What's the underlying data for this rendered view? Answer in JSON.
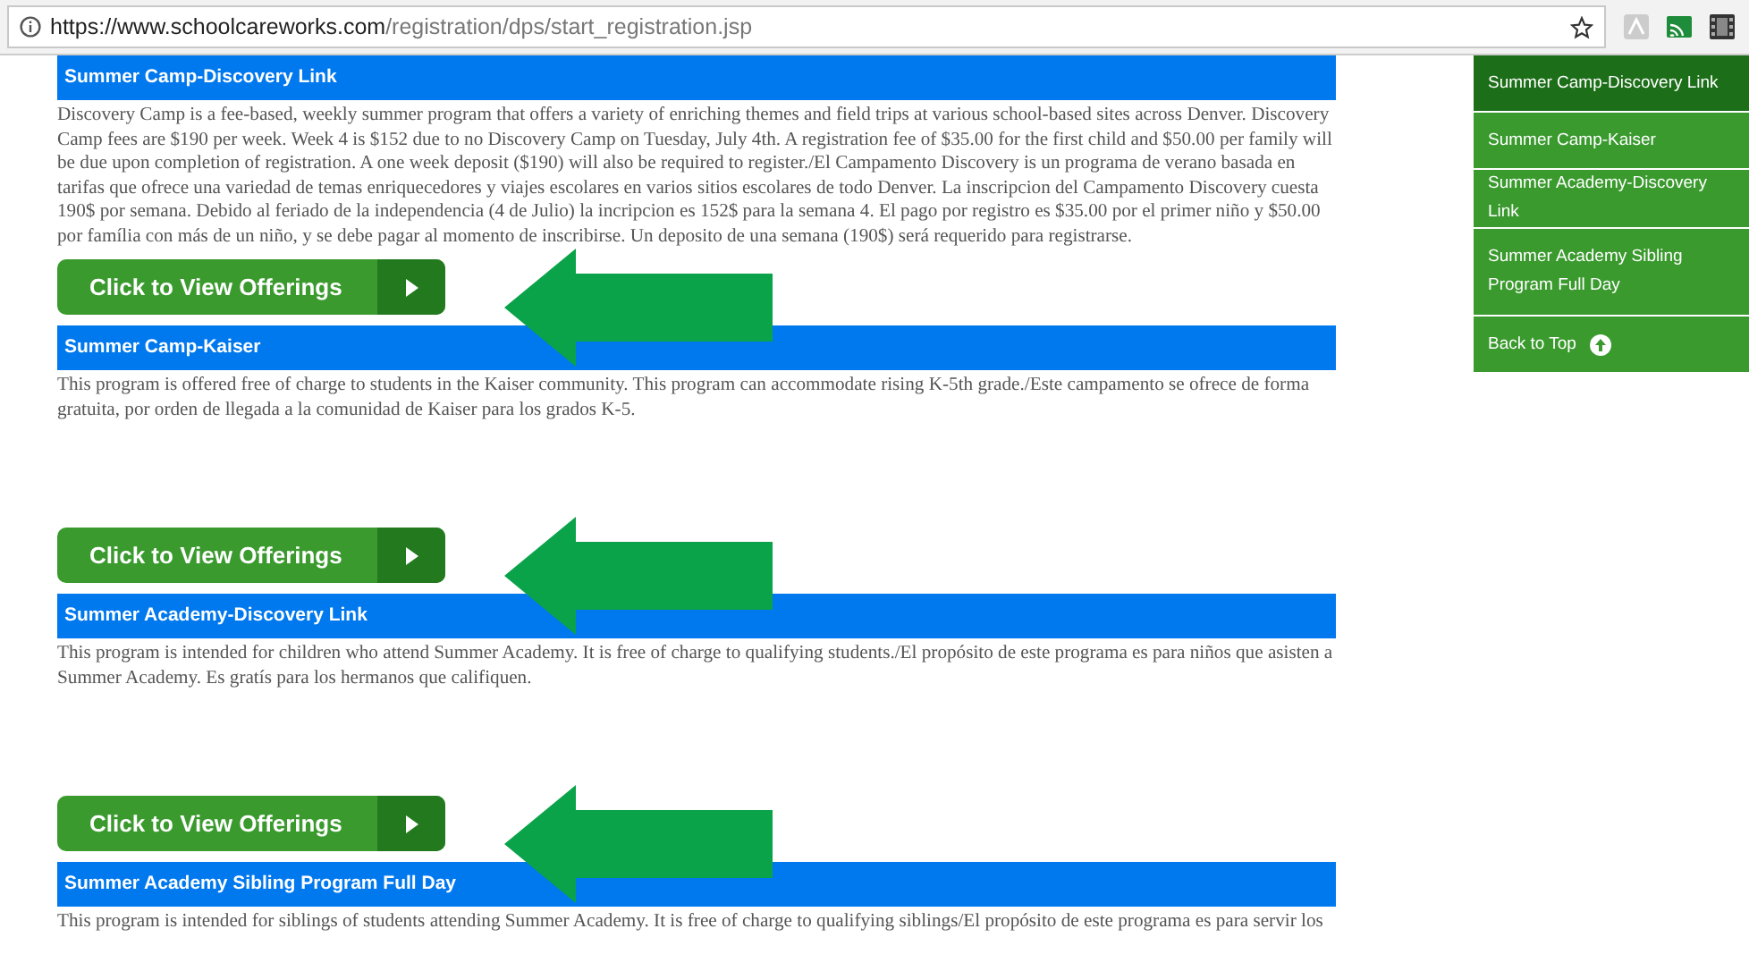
{
  "browser": {
    "url_host": "https://www.schoolcareworks.com",
    "url_path": "/registration/dps/start_registration.jsp"
  },
  "sections": [
    {
      "title": "Summer Camp-Discovery Link",
      "text": "Discovery Camp is a fee-based, weekly summer program that offers a variety of enriching themes and field trips at various school-based sites across Denver. Discovery Camp fees are $190 per week. Week 4 is $152 due to no Discovery Camp on Tuesday, July 4th. A registration fee of $35.00 for the first child and $50.00 per family will be due upon completion of registration.  A one week deposit ($190) will also be required to register./El Campamento Discovery is un programa de verano basada en tarifas que ofrece una variedad de temas enriquecedores y viajes escolares en varios sitios escolares de todo Denver. La inscripcion del Campamento Discovery cuesta 190$ por semana. Debido al feriado de la independencia (4 de Julio) la incripcion es 152$ para la semana 4. El pago por registro es $35.00 por el primer niño y $50.00 por família con más de un niño, y se debe pagar al momento de inscribirse. Un deposito de una semana (190$) será requerido para registrarse.",
      "button": "Click to View Offerings"
    },
    {
      "title": "Summer Camp-Kaiser",
      "text": "This program is offered free of charge to students in the Kaiser community. This program can accommodate rising K-5th grade./Este campamento se ofrece de forma gratuita, por orden de llegada a la comunidad de Kaiser para los grados K-5.",
      "button": "Click to View Offerings"
    },
    {
      "title": "Summer Academy-Discovery Link",
      "text": "This program is intended for children who attend Summer Academy. It is free of charge to qualifying students./El propósito de este programa es para niños que asisten a Summer Academy. Es gratís para los hermanos que califiquen.",
      "button": "Click to View Offerings"
    },
    {
      "title": "Summer Academy Sibling Program Full Day",
      "text": "This program is intended for siblings of students attending Summer Academy. It is free of charge to qualifying siblings/El propósito de este programa es para servir los"
    }
  ],
  "sidebar": {
    "items": [
      {
        "label": "Summer Camp-Discovery Link",
        "selected": true
      },
      {
        "label": "Summer Camp-Kaiser",
        "selected": false
      },
      {
        "label": "Summer Academy-Discovery Link",
        "selected": false
      },
      {
        "label": "Summer Academy Sibling Program Full Day",
        "selected": false
      }
    ],
    "back_to_top": "Back to Top"
  }
}
